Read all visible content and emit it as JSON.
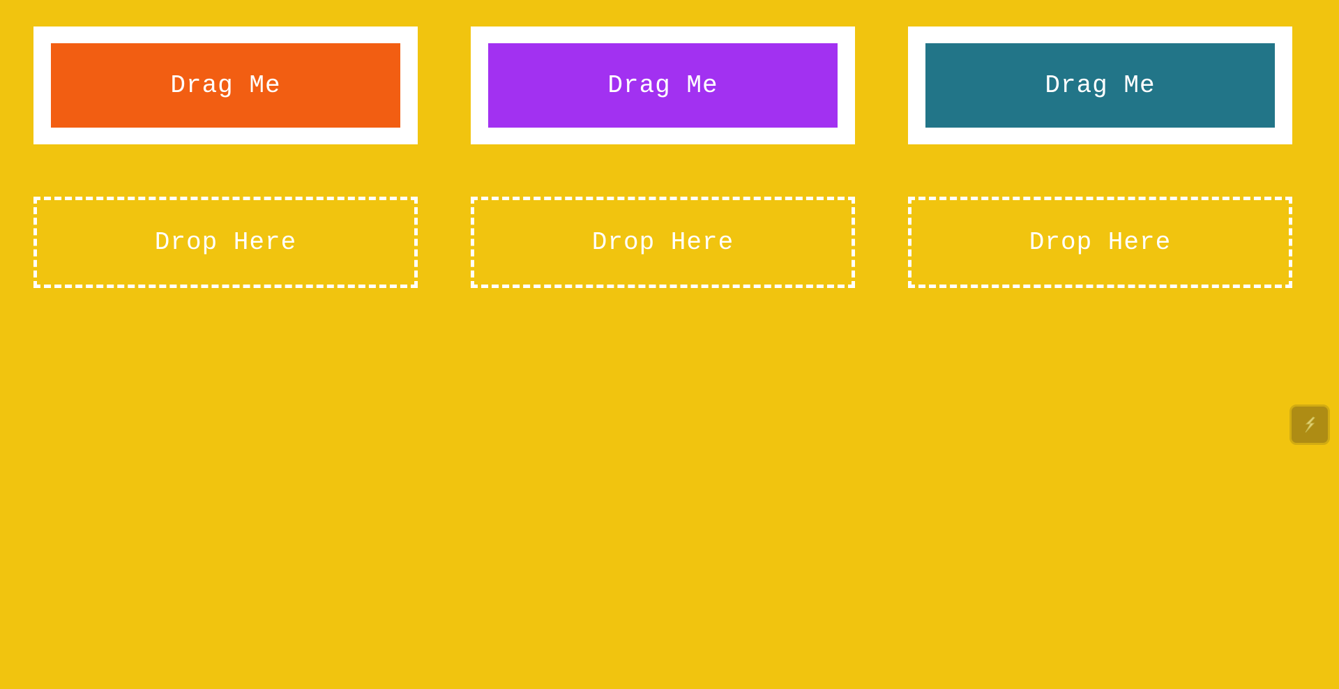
{
  "page": {
    "background_color": "#f1c40f"
  },
  "draggables": [
    {
      "label": "Drag Me",
      "color": "#f25e12"
    },
    {
      "label": "Drag Me",
      "color": "#a231f1"
    },
    {
      "label": "Drag Me",
      "color": "#227588"
    }
  ],
  "drop_zones": [
    {
      "label": "Drop Here"
    },
    {
      "label": "Drop Here"
    },
    {
      "label": "Drop Here"
    }
  ],
  "corner_widget": {
    "icon": "lightning-icon"
  }
}
